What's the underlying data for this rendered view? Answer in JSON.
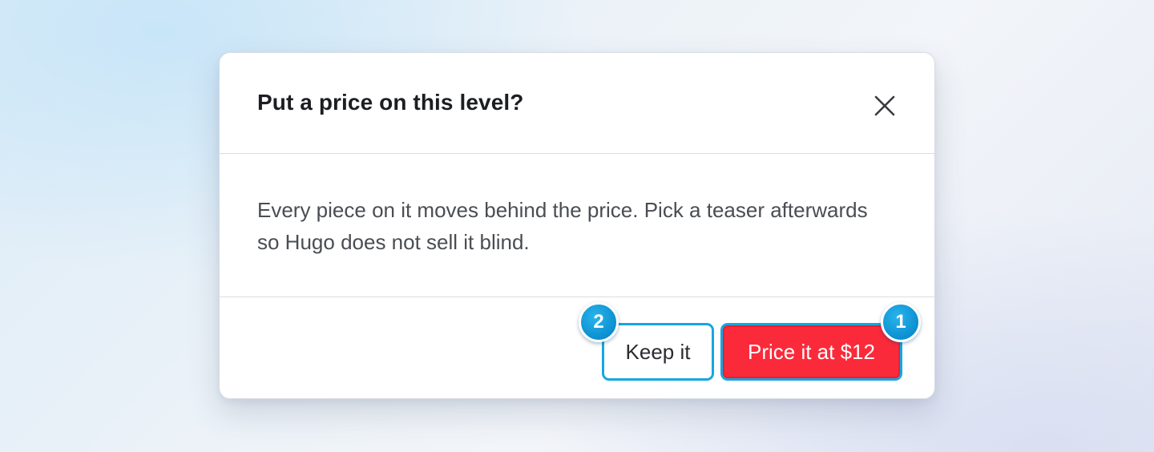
{
  "dialog": {
    "title": "Put a price on this level?",
    "close_icon": "close-icon",
    "message": "Every piece on it moves behind the price. Pick a teaser afterwards so Hugo does not sell it blind.",
    "buttons": {
      "keep_label": "Keep it",
      "price_label": "Price it at $12"
    },
    "badges": {
      "keep": "2",
      "price": "1"
    }
  },
  "colors": {
    "accent": "#16a6e0",
    "danger": "#fb2a3a",
    "badge": "#0b8fd0"
  }
}
